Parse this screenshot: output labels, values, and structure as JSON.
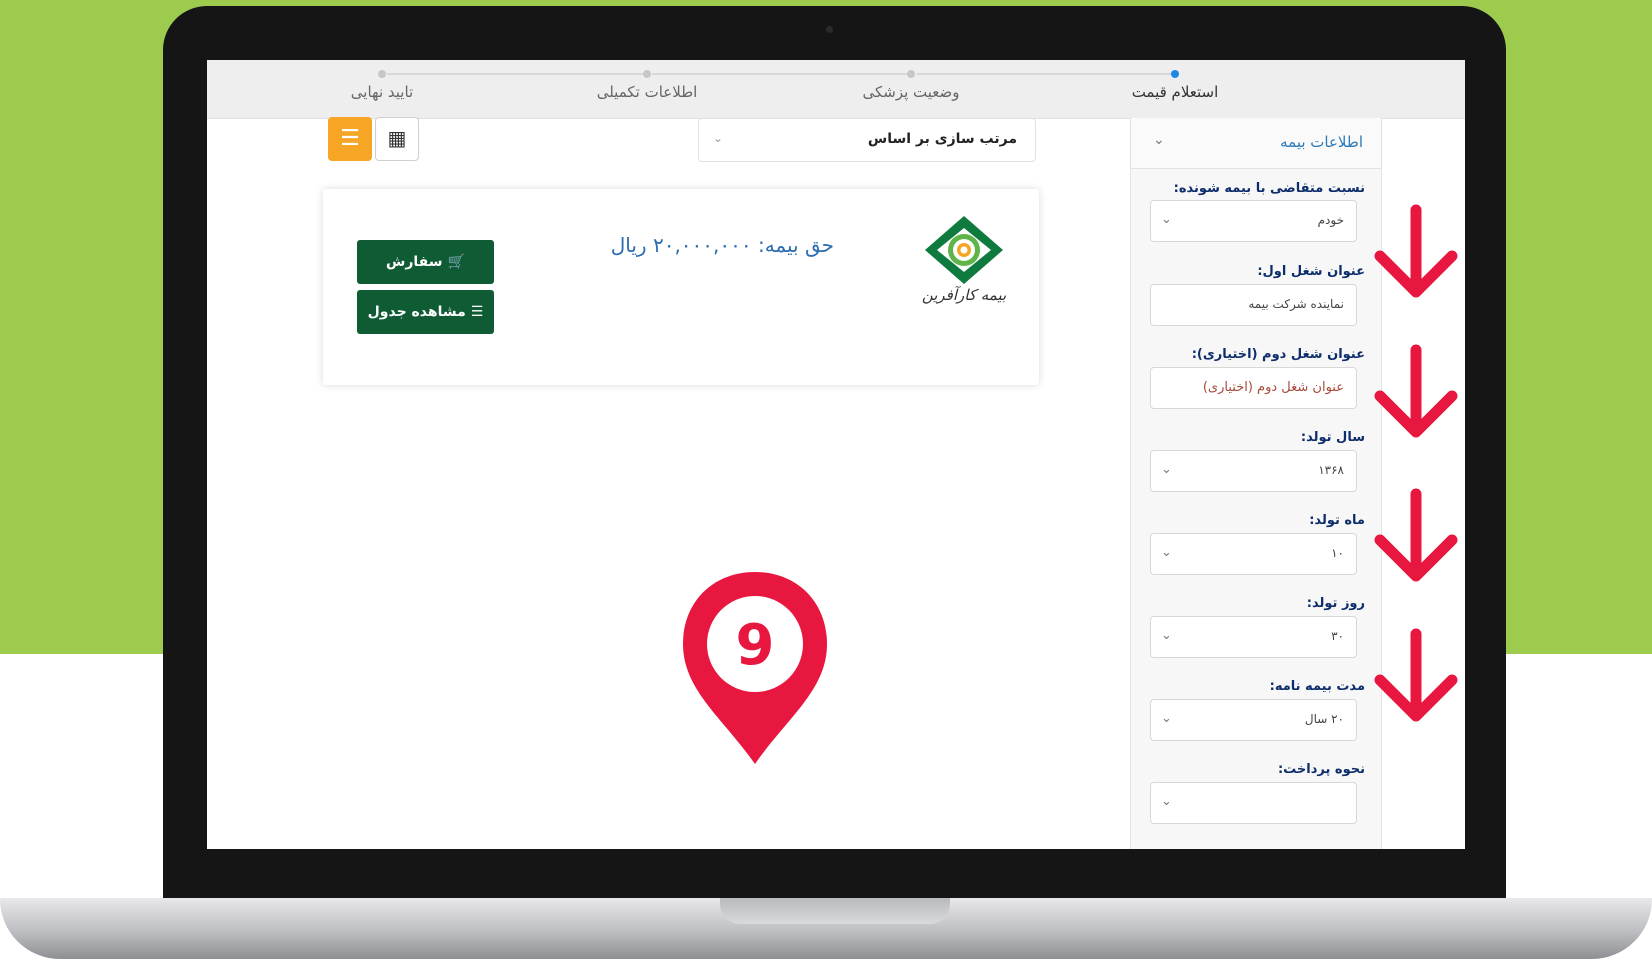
{
  "steps": [
    {
      "label": "استعلام قیمت",
      "active": true
    },
    {
      "label": "وضعیت پزشکی",
      "active": false
    },
    {
      "label": "اطلاعات تکمیلی",
      "active": false
    },
    {
      "label": "تایید نهایی",
      "active": false
    }
  ],
  "sidebar": {
    "title": "اطلاعات بیمه",
    "fields": [
      {
        "label": "نسبت متقاضی با بیمه شونده:",
        "value": "خودم",
        "type": "select"
      },
      {
        "label": "عنوان شغل اول:",
        "value": "نماینده شرکت بیمه",
        "type": "text"
      },
      {
        "label": "عنوان شغل دوم (اختیاری):",
        "value": "عنوان شغل دوم (اختیاری)",
        "type": "placeholder"
      },
      {
        "label": "سال تولد:",
        "value": "۱۳۶۸",
        "type": "select"
      },
      {
        "label": "ماه تولد:",
        "value": "۱۰",
        "type": "select"
      },
      {
        "label": "روز تولد:",
        "value": "۳۰",
        "type": "select"
      },
      {
        "label": "مدت بیمه نامه:",
        "value": "۲۰ سال",
        "type": "select"
      },
      {
        "label": "نحوه پرداخت:",
        "value": "",
        "type": "select"
      }
    ]
  },
  "sort": {
    "label": "مرتب سازی بر اساس"
  },
  "result": {
    "premium_text": "حق بیمه:  ۲۰,۰۰۰,۰۰۰ ریال",
    "order_label": "سفارش",
    "table_label": "مشاهده جدول",
    "company_logo_text": "بیمه کارآفرین"
  },
  "marker": {
    "number": "9"
  },
  "colors": {
    "brand_green": "#0f5b34",
    "accent_orange": "#f6a524",
    "active_step": "#1e88e5",
    "annotation_red": "#e8173f",
    "background_green": "#9ccb4e"
  },
  "icons": [
    "cart-icon",
    "list-icon",
    "grid-icon",
    "hamburger-icon",
    "chevron-down-icon",
    "location-pin-icon",
    "down-arrow-icon"
  ]
}
